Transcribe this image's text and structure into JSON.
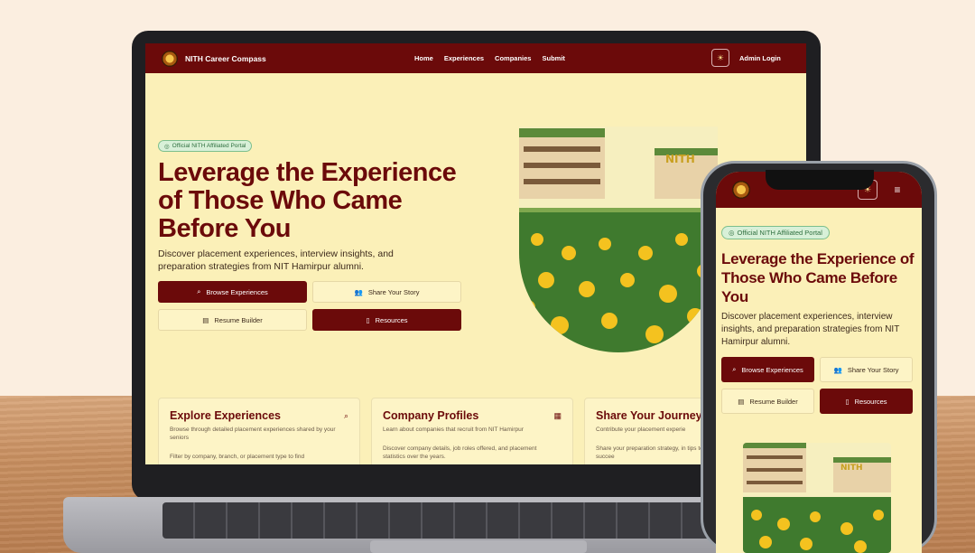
{
  "brand": {
    "name": "NITH Career Compass"
  },
  "nav": {
    "links": [
      "Home",
      "Experiences",
      "Companies",
      "Submit"
    ],
    "admin_label": "Admin Login"
  },
  "hero": {
    "badge": "Official NITH Affiliated Portal",
    "title": "Leverage the Experience of Those Who Came Before You",
    "subtitle": "Discover placement experiences, interview insights, and preparation strategies from NIT Hamirpur alumni.",
    "buttons": {
      "browse": "Browse Experiences",
      "share": "Share Your Story",
      "resume": "Resume Builder",
      "resources": "Resources"
    },
    "sign_text": "NITH"
  },
  "cards": [
    {
      "title": "Explore Experiences",
      "desc": "Browse through detailed placement experiences shared by your seniors",
      "extra": "Filter by company, branch, or placement type to find"
    },
    {
      "title": "Company Profiles",
      "desc": "Learn about companies that recruit from NIT Hamirpur",
      "extra": "Discover company details, job roles offered, and placement statistics over the years."
    },
    {
      "title": "Share Your Journey",
      "desc": "Contribute your placement experie",
      "extra": "Share your preparation strategy, in tips to help future batches succee"
    }
  ],
  "icons": {
    "theme": "sun-icon",
    "menu": "hamburger-icon",
    "search": "search-icon",
    "users": "users-icon",
    "file": "file-icon",
    "book": "book-icon",
    "building": "building-icon"
  },
  "colors": {
    "primary": "#6b0a0a",
    "background": "#fbf0b8",
    "badge": "#d8f0d8"
  }
}
